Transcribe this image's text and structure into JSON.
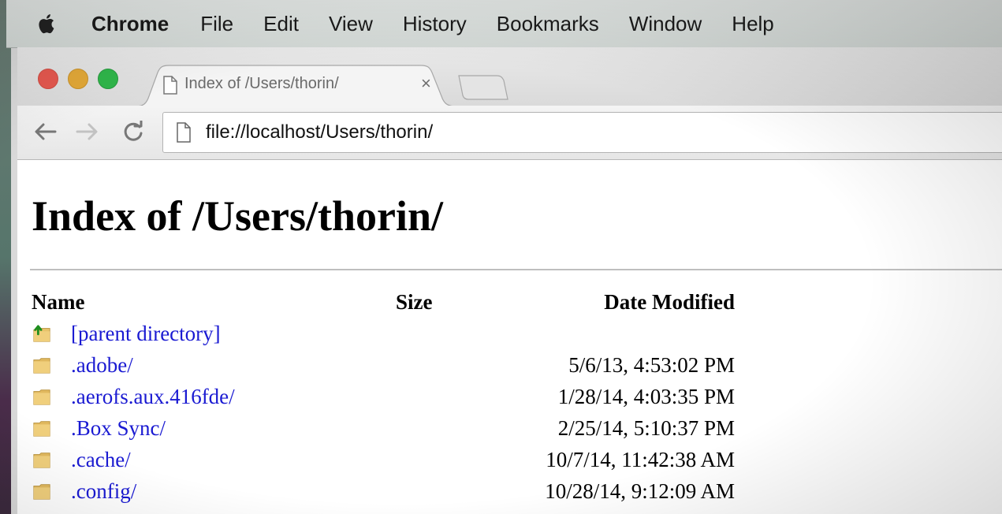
{
  "menubar": {
    "app_name": "Chrome",
    "items": [
      "File",
      "Edit",
      "View",
      "History",
      "Bookmarks",
      "Window",
      "Help"
    ]
  },
  "window": {
    "tab": {
      "title": "Index of /Users/thorin/",
      "close_glyph": "×"
    },
    "toolbar": {
      "url": "file://localhost/Users/thorin/"
    }
  },
  "page": {
    "heading": "Index of /Users/thorin/",
    "columns": {
      "name": "Name",
      "size": "Size",
      "date": "Date Modified"
    },
    "rows": [
      {
        "name": "[parent directory]",
        "size": "",
        "date": "",
        "icon": "parent-folder-icon"
      },
      {
        "name": ".adobe/",
        "size": "",
        "date": "5/6/13, 4:53:02 PM",
        "icon": "folder-icon"
      },
      {
        "name": ".aerofs.aux.416fde/",
        "size": "",
        "date": "1/28/14, 4:03:35 PM",
        "icon": "folder-icon"
      },
      {
        "name": ".Box Sync/",
        "size": "",
        "date": "2/25/14, 5:10:37 PM",
        "icon": "folder-icon"
      },
      {
        "name": ".cache/",
        "size": "",
        "date": "10/7/14, 11:42:38 AM",
        "icon": "folder-icon"
      },
      {
        "name": ".config/",
        "size": "",
        "date": "10/28/14, 9:12:09 AM",
        "icon": "folder-icon"
      }
    ]
  },
  "colors": {
    "link": "#1a1ad2",
    "traffic_red": "#e5584f",
    "traffic_yellow": "#e2a838",
    "traffic_green": "#2fb64a"
  }
}
